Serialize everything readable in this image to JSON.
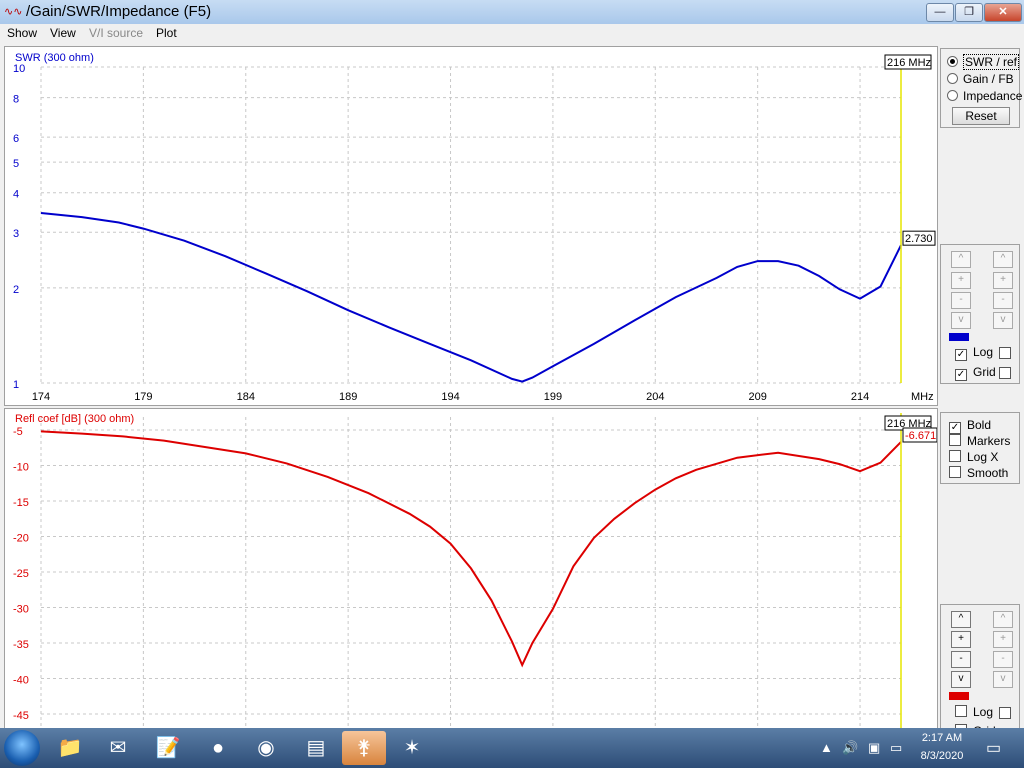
{
  "window": {
    "title": "/Gain/SWR/Impedance (F5)",
    "app_icon": "wave-icon",
    "min_label": "—",
    "max_label": "❐",
    "close_label": "✕"
  },
  "menu": [
    "Show",
    "View",
    "V/I source",
    "Plot"
  ],
  "menu_disabled": [
    false,
    false,
    true,
    false
  ],
  "swr_plot": {
    "label": "SWR (300 ohm)",
    "marker_freq": "216 MHz",
    "marker_value": "2.730",
    "color": "#0000cc",
    "y_ticks": [
      "10",
      "8",
      "6",
      "5",
      "4",
      "3",
      "2",
      "1"
    ],
    "x_ticks": [
      "174",
      "179",
      "184",
      "189",
      "194",
      "199",
      "204",
      "209",
      "214"
    ],
    "x_unit": "MHz"
  },
  "refl_plot": {
    "label": "Refl coef [dB] (300 ohm)",
    "marker_freq": "216 MHz",
    "marker_value": "-6.671",
    "color": "#dd0000",
    "y_ticks": [
      "-5",
      "-10",
      "-15",
      "-20",
      "-25",
      "-30",
      "-35",
      "-40",
      "-45"
    ]
  },
  "chart_data": [
    {
      "type": "line",
      "ylabel": "SWR (300 ohm)",
      "xlabel": "MHz",
      "xlim": [
        174,
        216
      ],
      "ylim": [
        1,
        10
      ],
      "yscale": "log",
      "grid": true,
      "x": [
        174,
        176,
        177.8,
        179,
        181,
        183,
        185,
        187,
        189,
        191,
        193,
        195,
        197,
        197.5,
        198,
        199,
        201,
        203,
        205,
        207,
        208,
        209,
        210,
        211,
        212,
        213,
        214,
        215,
        216
      ],
      "series": [
        {
          "values": [
            3.45,
            3.35,
            3.22,
            3.08,
            2.82,
            2.52,
            2.22,
            1.95,
            1.7,
            1.5,
            1.33,
            1.18,
            1.03,
            1.01,
            1.04,
            1.13,
            1.33,
            1.58,
            1.87,
            2.15,
            2.33,
            2.43,
            2.43,
            2.35,
            2.18,
            1.98,
            1.85,
            2.02,
            2.73
          ]
        }
      ]
    },
    {
      "type": "line",
      "ylabel": "Refl coef [dB] (300 ohm)",
      "xlim": [
        174,
        216
      ],
      "ylim": [
        -48,
        -4
      ],
      "grid": true,
      "x": [
        174,
        176,
        178,
        180,
        184,
        186,
        188,
        190,
        192,
        193,
        194,
        195,
        196,
        197,
        197.5,
        198,
        199,
        200,
        201,
        202,
        203,
        204,
        205,
        206,
        208,
        210,
        212,
        213,
        214,
        215,
        216
      ],
      "series": [
        {
          "values": [
            -5.2,
            -5.5,
            -5.9,
            -6.5,
            -8.3,
            -9.7,
            -11.6,
            -13.9,
            -16.8,
            -18.6,
            -21.0,
            -24.5,
            -29.0,
            -34.8,
            -38.1,
            -35.0,
            -30.2,
            -24.2,
            -20.2,
            -17.5,
            -15.3,
            -13.4,
            -11.8,
            -10.6,
            -8.9,
            -8.2,
            -9.1,
            -9.8,
            -10.8,
            -9.6,
            -6.67
          ]
        }
      ]
    }
  ],
  "controls_top": {
    "options": [
      "SWR / ref",
      "Gain / FB",
      "Impedance"
    ],
    "selected": 0,
    "reset_label": "Reset"
  },
  "scale_controls": {
    "buttons": [
      "^",
      "+",
      "-",
      "v"
    ],
    "log_label": "Log",
    "grid_label": "Grid"
  },
  "options_panel": {
    "bold_label": "Bold",
    "markers_label": "Markers",
    "logx_label": "Log X",
    "smooth_label": "Smooth"
  },
  "taskbar": {
    "apps": [
      {
        "name": "folder-icon",
        "glyph": "📁"
      },
      {
        "name": "mail-icon",
        "glyph": "✉"
      },
      {
        "name": "notepad-icon",
        "glyph": "📝"
      },
      {
        "name": "globe-icon",
        "glyph": "●"
      },
      {
        "name": "chrome-icon",
        "glyph": "◉"
      },
      {
        "name": "app-icon",
        "glyph": "▤"
      },
      {
        "name": "antenna-icon",
        "glyph": "⚵"
      },
      {
        "name": "bird-icon",
        "glyph": "✶"
      }
    ],
    "time": "2:17 AM",
    "date": "8/3/2020"
  }
}
